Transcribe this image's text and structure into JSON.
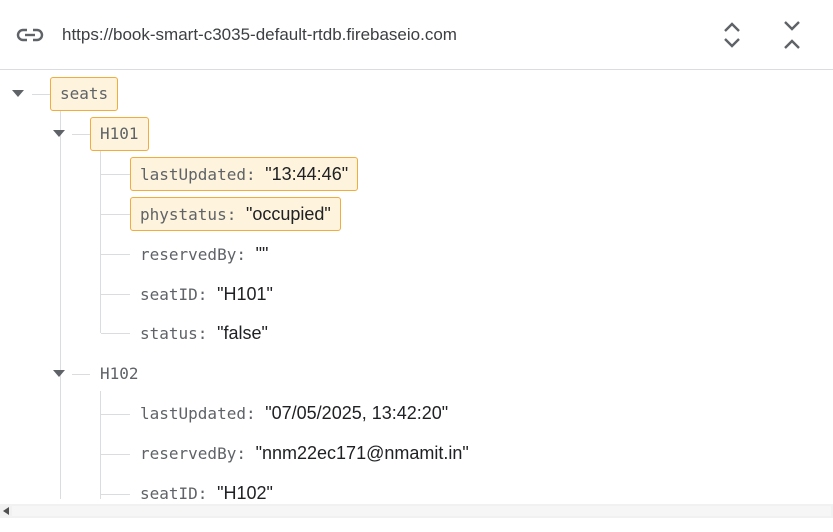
{
  "toolbar": {
    "url": "https://book-smart-c3035-default-rtdb.firebaseio.com",
    "link_icon": "link-icon",
    "expand_icon": "unfold-more-icon",
    "collapse_icon": "unfold-less-icon"
  },
  "tree": {
    "root": {
      "key": "seats",
      "children": [
        {
          "key": "H101",
          "fields": [
            {
              "key": "lastUpdated",
              "value": "\"13:44:46\""
            },
            {
              "key": "phystatus",
              "value": "\"occupied\""
            },
            {
              "key": "reservedBy",
              "value": "\"\""
            },
            {
              "key": "seatID",
              "value": "\"H101\""
            },
            {
              "key": "status",
              "value": "\"false\""
            }
          ]
        },
        {
          "key": "H102",
          "fields": [
            {
              "key": "lastUpdated",
              "value": "\"07/05/2025, 13:42:20\""
            },
            {
              "key": "reservedBy",
              "value": "\"nnm22ec171@nmamit.in\""
            },
            {
              "key": "seatID",
              "value": "\"H102\""
            }
          ]
        }
      ]
    }
  },
  "colon": ":",
  "colors": {
    "highlight_bg": "#fef3dc",
    "highlight_border": "#f2ac3c",
    "tree_line": "#dadce0"
  }
}
